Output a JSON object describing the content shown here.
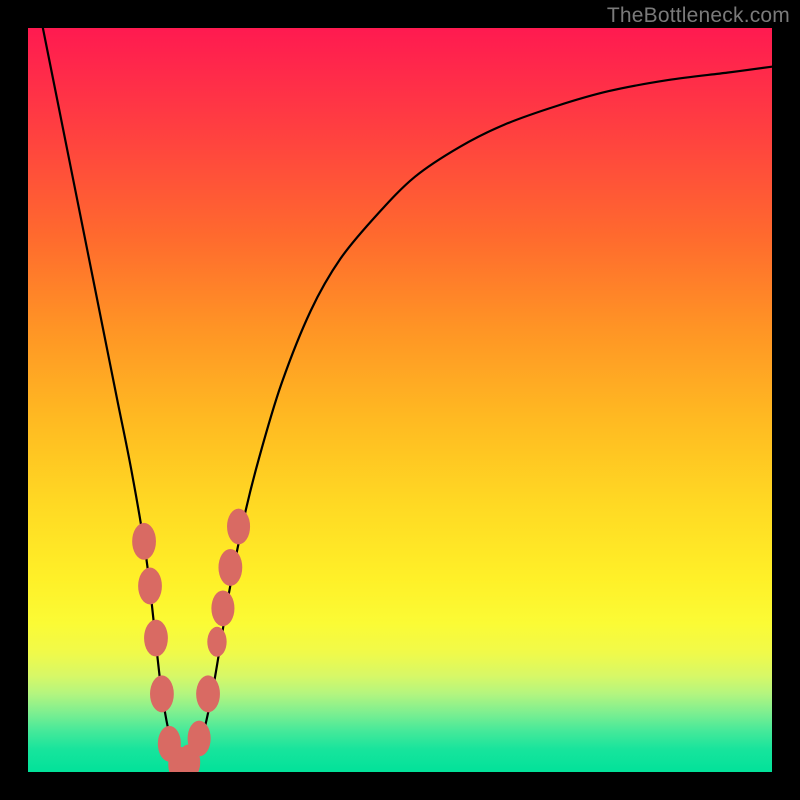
{
  "watermark": "TheBottleneck.com",
  "colors": {
    "frame": "#000000",
    "curve": "#000000",
    "marker": "#d96a63",
    "gradient_top": "#ff1a50",
    "gradient_bottom": "#02e29a"
  },
  "chart_data": {
    "type": "line",
    "title": "",
    "xlabel": "",
    "ylabel": "",
    "xlim": [
      0,
      100
    ],
    "ylim": [
      0,
      100
    ],
    "grid": false,
    "series": [
      {
        "name": "bottleneck-curve",
        "x": [
          2,
          4,
          6,
          8,
          10,
          12,
          14,
          16,
          17.8,
          19,
          20,
          21,
          22,
          23.5,
          25,
          27,
          29,
          31,
          34,
          38,
          42,
          47,
          52,
          58,
          64,
          71,
          78,
          86,
          94,
          100
        ],
        "y": [
          100,
          90,
          80,
          70,
          60,
          50,
          40,
          28,
          12,
          5,
          1.5,
          1,
          1.5,
          5,
          12,
          24,
          34,
          42,
          52,
          62,
          69,
          75,
          80,
          84,
          87,
          89.5,
          91.5,
          93,
          94,
          94.8
        ]
      }
    ],
    "markers": [
      {
        "x": 15.6,
        "y": 31,
        "r": 1.6
      },
      {
        "x": 16.4,
        "y": 25,
        "r": 1.6
      },
      {
        "x": 17.2,
        "y": 18,
        "r": 1.6
      },
      {
        "x": 18.0,
        "y": 10.5,
        "r": 1.6
      },
      {
        "x": 19.0,
        "y": 3.8,
        "r": 1.55
      },
      {
        "x": 20.4,
        "y": 1.0,
        "r": 1.55
      },
      {
        "x": 21.6,
        "y": 1.3,
        "r": 1.55
      },
      {
        "x": 23.0,
        "y": 4.5,
        "r": 1.55
      },
      {
        "x": 24.2,
        "y": 10.5,
        "r": 1.6
      },
      {
        "x": 25.4,
        "y": 17.5,
        "r": 1.3
      },
      {
        "x": 26.2,
        "y": 22,
        "r": 1.55
      },
      {
        "x": 27.2,
        "y": 27.5,
        "r": 1.6
      },
      {
        "x": 28.3,
        "y": 33,
        "r": 1.55
      }
    ]
  }
}
